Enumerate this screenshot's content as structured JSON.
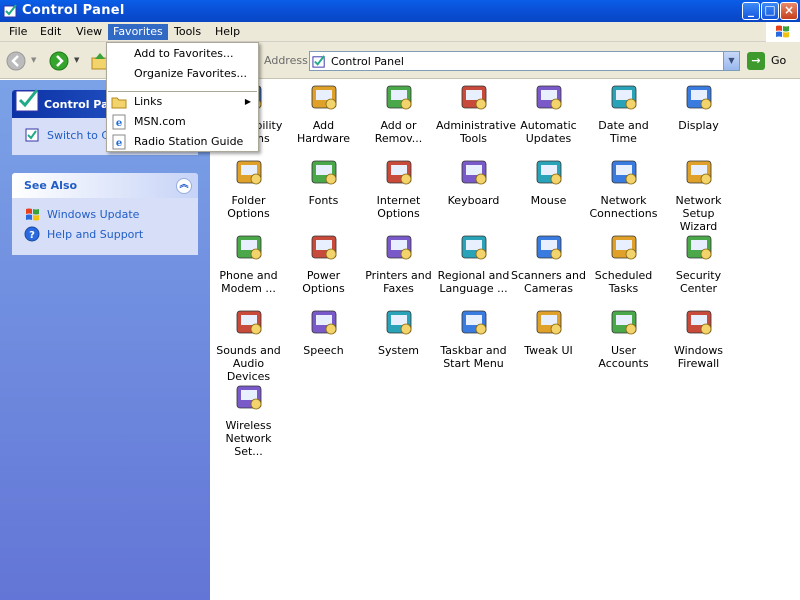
{
  "window": {
    "title": "Control Panel"
  },
  "titlebar_buttons": {
    "minimize": "_",
    "maximize": "□",
    "close": "×"
  },
  "menubar": {
    "items": [
      "File",
      "Edit",
      "View",
      "Favorites",
      "Tools",
      "Help"
    ],
    "active": "Favorites"
  },
  "toolbar": {
    "address_label": "Address",
    "address_value": "Control Panel",
    "go_label": "Go"
  },
  "favorites_menu": {
    "items": [
      {
        "label": "Add to Favorites...",
        "icon": ""
      },
      {
        "label": "Organize Favorites...",
        "icon": ""
      },
      {
        "label": "Links",
        "icon": "folder-icon",
        "submenu": true
      },
      {
        "label": "MSN.com",
        "icon": "ie-page-icon"
      },
      {
        "label": "Radio Station Guide",
        "icon": "ie-page-icon"
      }
    ]
  },
  "left_pane": {
    "control_panel_title": "Control Panel",
    "switch_view_label": "Switch to Ca",
    "see_also_title": "See Also",
    "see_also_items": [
      "Windows Update",
      "Help and Support"
    ]
  },
  "icons": [
    {
      "label": "Accessibility\nOptions",
      "icon": "accessibility-icon"
    },
    {
      "label": "Add Hardware",
      "icon": "add-hardware-icon"
    },
    {
      "label": "Add or\nRemov...",
      "icon": "add-remove-programs-icon"
    },
    {
      "label": "Administrative\nTools",
      "icon": "administrative-tools-icon"
    },
    {
      "label": "Automatic\nUpdates",
      "icon": "automatic-updates-icon"
    },
    {
      "label": "Date and Time",
      "icon": "date-time-icon"
    },
    {
      "label": "Display",
      "icon": "display-icon"
    },
    {
      "label": "Folder Options",
      "icon": "folder-options-icon"
    },
    {
      "label": "Fonts",
      "icon": "fonts-icon"
    },
    {
      "label": "Internet\nOptions",
      "icon": "internet-options-icon"
    },
    {
      "label": "Keyboard",
      "icon": "keyboard-icon"
    },
    {
      "label": "Mouse",
      "icon": "mouse-icon"
    },
    {
      "label": "Network\nConnections",
      "icon": "network-connections-icon"
    },
    {
      "label": "Network Setup\nWizard",
      "icon": "network-setup-wizard-icon"
    },
    {
      "label": "Phone and\nModem ...",
      "icon": "phone-modem-icon"
    },
    {
      "label": "Power Options",
      "icon": "power-options-icon"
    },
    {
      "label": "Printers and\nFaxes",
      "icon": "printers-faxes-icon"
    },
    {
      "label": "Regional and\nLanguage ...",
      "icon": "regional-language-icon"
    },
    {
      "label": "Scanners and\nCameras",
      "icon": "scanners-cameras-icon"
    },
    {
      "label": "Scheduled\nTasks",
      "icon": "scheduled-tasks-icon"
    },
    {
      "label": "Security\nCenter",
      "icon": "security-center-icon"
    },
    {
      "label": "Sounds and\nAudio Devices",
      "icon": "sounds-audio-icon"
    },
    {
      "label": "Speech",
      "icon": "speech-icon"
    },
    {
      "label": "System",
      "icon": "system-icon"
    },
    {
      "label": "Taskbar and\nStart Menu",
      "icon": "taskbar-start-menu-icon"
    },
    {
      "label": "Tweak UI",
      "icon": "tweak-ui-icon"
    },
    {
      "label": "User Accounts",
      "icon": "user-accounts-icon"
    },
    {
      "label": "Windows\nFirewall",
      "icon": "windows-firewall-icon"
    },
    {
      "label": "Wireless\nNetwork Set...",
      "icon": "wireless-network-icon"
    }
  ],
  "colors": {
    "titlebar": "#0a50d7",
    "left_pane": "#6375d6",
    "link": "#215dc6",
    "menu_highlight": "#316ac5"
  }
}
